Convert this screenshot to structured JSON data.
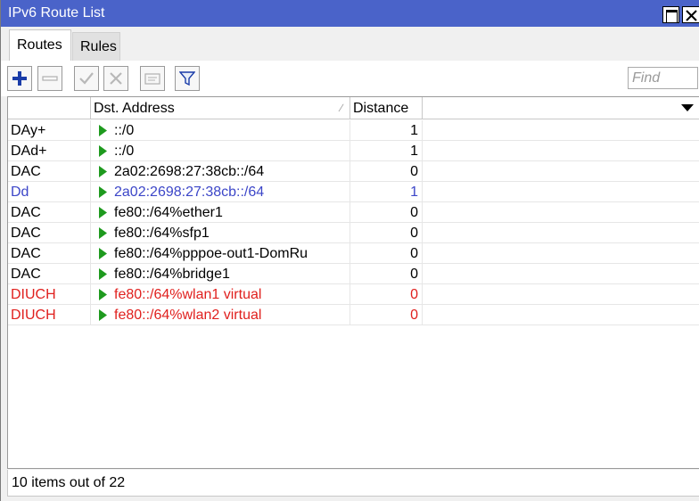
{
  "window": {
    "title": "IPv6 Route List"
  },
  "tabs": [
    {
      "label": "Routes",
      "active": true
    },
    {
      "label": "Rules",
      "active": false
    }
  ],
  "toolbar": {
    "buttons": [
      "add-icon",
      "remove-icon",
      "enable-icon",
      "disable-icon",
      "comment-icon",
      "filter-icon"
    ],
    "find_placeholder": "Find",
    "accent_color": "#1a3ca8"
  },
  "table": {
    "columns": [
      "",
      "Dst. Address",
      "Distance"
    ],
    "rows": [
      {
        "flags": "DAy+",
        "dst": "::/0",
        "distance": "1",
        "color": "normal"
      },
      {
        "flags": "DAd+",
        "dst": "::/0",
        "distance": "1",
        "color": "normal"
      },
      {
        "flags": "DAC",
        "dst": "2a02:2698:27:38cb::/64",
        "distance": "0",
        "color": "normal"
      },
      {
        "flags": "Dd",
        "dst": "2a02:2698:27:38cb::/64",
        "distance": "1",
        "color": "blue"
      },
      {
        "flags": "DAC",
        "dst": "fe80::/64%ether1",
        "distance": "0",
        "color": "normal"
      },
      {
        "flags": "DAC",
        "dst": "fe80::/64%sfp1",
        "distance": "0",
        "color": "normal"
      },
      {
        "flags": "DAC",
        "dst": "fe80::/64%pppoe-out1-DomRu",
        "distance": "0",
        "color": "normal"
      },
      {
        "flags": "DAC",
        "dst": "fe80::/64%bridge1",
        "distance": "0",
        "color": "normal"
      },
      {
        "flags": "DIUCH",
        "dst": "fe80::/64%wlan1 virtual",
        "distance": "0",
        "color": "red"
      },
      {
        "flags": "DIUCH",
        "dst": "fe80::/64%wlan2 virtual",
        "distance": "0",
        "color": "red"
      }
    ]
  },
  "status": {
    "text": "10 items out of 22"
  },
  "colors": {
    "titlebar": "#4a63c9",
    "blue_row": "#3c46c8",
    "red_row": "#e0201e",
    "arrow": "#1e9a1e"
  }
}
